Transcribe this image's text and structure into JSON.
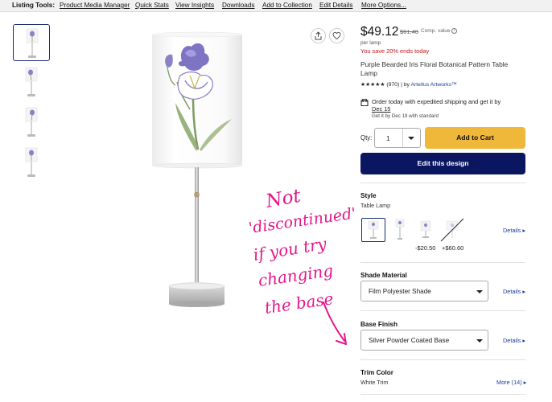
{
  "toolbar": {
    "label": "Listing Tools:",
    "links": [
      "Product Media Manager",
      "Quick Stats",
      "View Insights",
      "Downloads",
      "Add to Collection",
      "Edit Details",
      "More Options..."
    ]
  },
  "product": {
    "price": "$49.12",
    "old_price": "$61.40",
    "comp_value": "Comp. value",
    "info_icon": "i",
    "per_unit": "per lamp",
    "savings": "You save 20% ends today",
    "title": "Purple Bearded Iris Floral Botanical Pattern Table Lamp",
    "stars": "★★★★★",
    "review_count": "(970)",
    "by": "by",
    "artist": "Artellus Artworks™"
  },
  "shipping": {
    "line1": "Order today with expedited shipping and get it by",
    "date": "Dec 15",
    "line2": "Get it by Dec 19 with standard"
  },
  "purchase": {
    "qty_label": "Qty:",
    "qty_value": "1",
    "add_to_cart": "Add to Cart",
    "edit_design": "Edit this design"
  },
  "style": {
    "heading": "Style",
    "selected": "Table Lamp",
    "option_prices": [
      "-$20.50",
      "+$60.60"
    ],
    "details": "Details"
  },
  "shade": {
    "heading": "Shade Material",
    "value": "Film Polyester Shade",
    "details": "Details"
  },
  "base": {
    "heading": "Base Finish",
    "value": "Silver Powder Coated Base",
    "details": "Details"
  },
  "trim": {
    "heading": "Trim Color",
    "value": "White Trim",
    "more": "More (14)"
  },
  "annotation": {
    "lines": [
      "Not",
      "'discontinued'",
      "if you try",
      "changing",
      "the base"
    ],
    "color": "#e5168c"
  },
  "colors": {
    "add_to_cart": "#f0b83a",
    "edit_design": "#0b1660",
    "sale_red": "#c4161c",
    "link_blue": "#1a3d9c"
  }
}
